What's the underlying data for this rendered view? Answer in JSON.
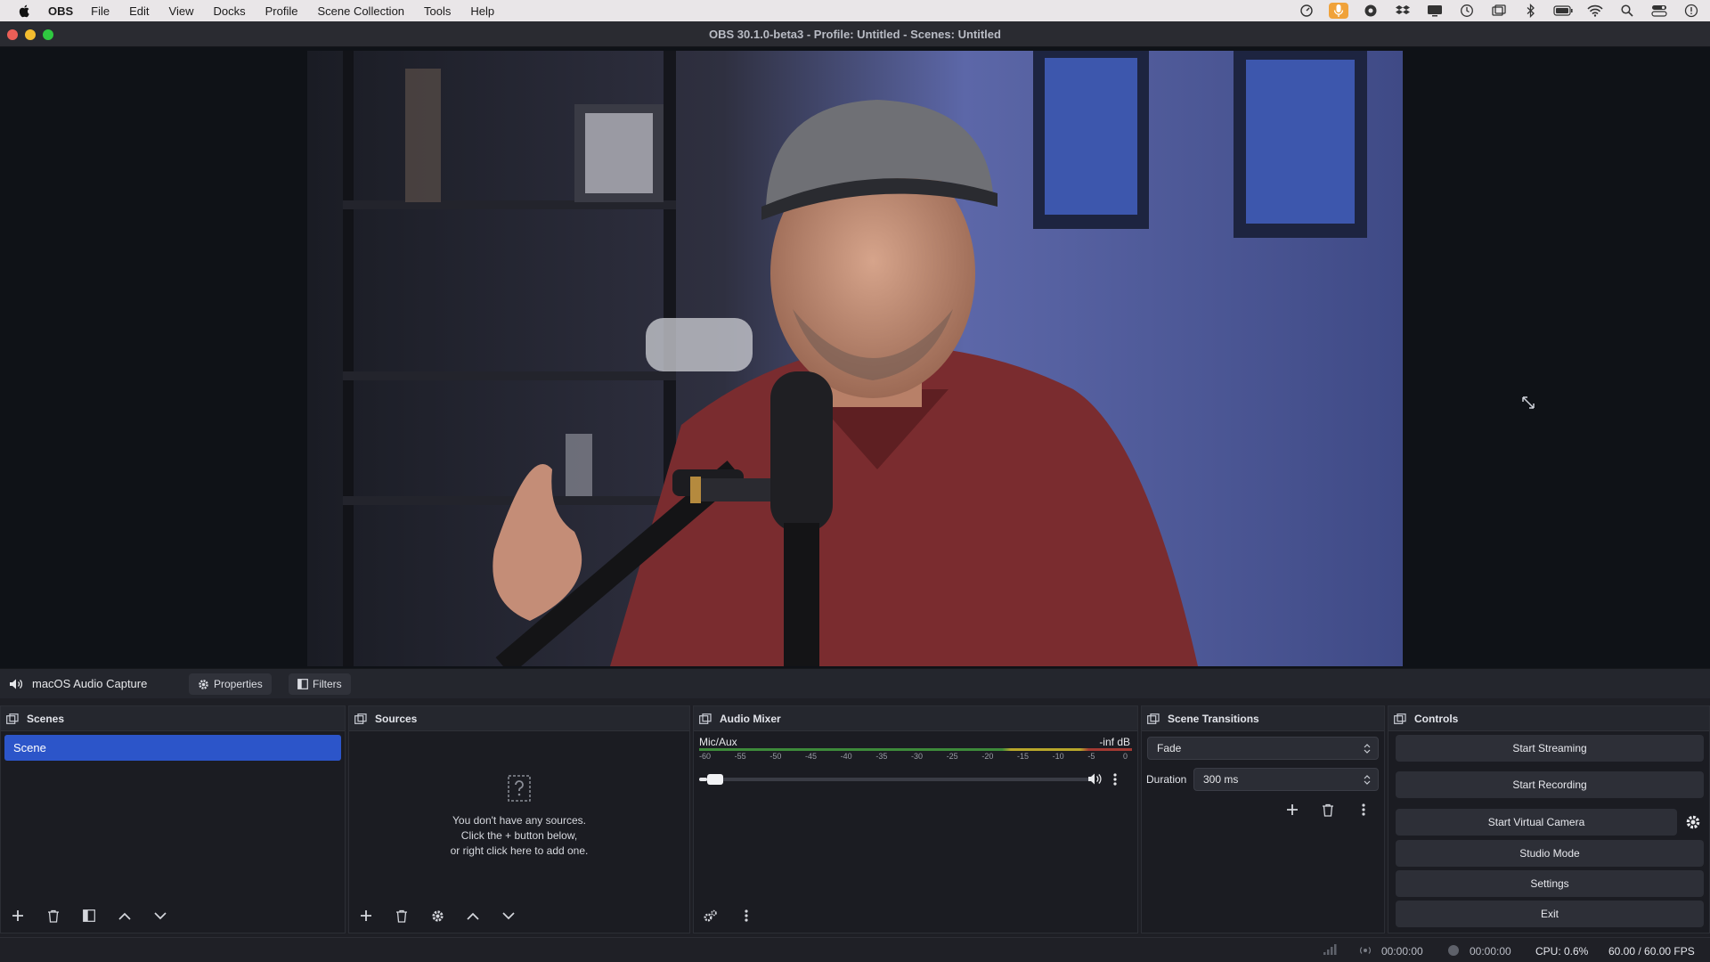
{
  "menubar": {
    "app": "OBS",
    "items": [
      "File",
      "Edit",
      "View",
      "Docks",
      "Profile",
      "Scene Collection",
      "Tools",
      "Help"
    ]
  },
  "window": {
    "title": "OBS 30.1.0-beta3 - Profile: Untitled - Scenes: Untitled"
  },
  "source_bar": {
    "source_name": "macOS Audio Capture",
    "properties_label": "Properties",
    "filters_label": "Filters"
  },
  "scenes": {
    "title": "Scenes",
    "items": [
      "Scene"
    ]
  },
  "sources": {
    "title": "Sources",
    "empty_line1": "You don't have any sources.",
    "empty_line2": "Click the + button below,",
    "empty_line3": "or right click here to add one."
  },
  "audio_mixer": {
    "title": "Audio Mixer",
    "channel": "Mic/Aux",
    "level": "-inf dB",
    "scale": [
      "-60",
      "-55",
      "-50",
      "-45",
      "-40",
      "-35",
      "-30",
      "-25",
      "-20",
      "-15",
      "-10",
      "-5",
      "0"
    ],
    "volume_fraction": 0.02
  },
  "transitions": {
    "title": "Scene Transitions",
    "selected": "Fade",
    "duration_label": "Duration",
    "duration_value": "300 ms"
  },
  "controls": {
    "title": "Controls",
    "start_streaming": "Start Streaming",
    "start_recording": "Start Recording",
    "start_virtual_camera": "Start Virtual Camera",
    "studio_mode": "Studio Mode",
    "settings": "Settings",
    "exit": "Exit"
  },
  "status": {
    "stream_time": "00:00:00",
    "record_time": "00:00:00",
    "cpu": "CPU: 0.6%",
    "fps": "60.00 / 60.00 FPS"
  },
  "colors": {
    "accent": "#2c55c9",
    "background": "#1e1f25",
    "dock_bg": "#1b1c22"
  }
}
